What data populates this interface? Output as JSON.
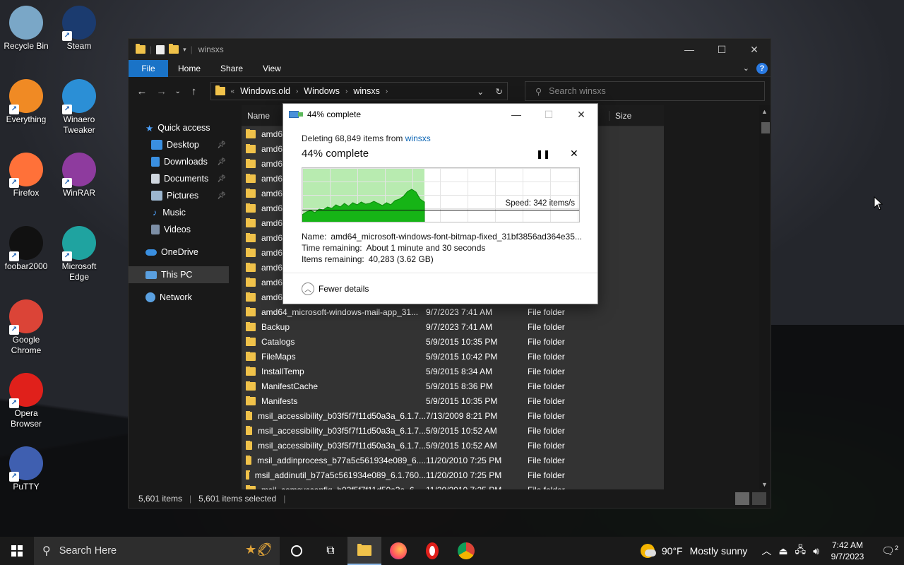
{
  "desktop": {
    "icons": [
      {
        "label": "Recycle Bin",
        "icon": "recycle-bin-icon",
        "color": "#7aa7c7"
      },
      {
        "label": "Steam",
        "icon": "steam-icon",
        "color": "#1b3b6f"
      },
      {
        "label": "Everything",
        "icon": "everything-icon",
        "color": "#f08a24"
      },
      {
        "label": "Winaero Tweaker",
        "icon": "winaero-tweaker-icon",
        "color": "#2b8fd6"
      },
      {
        "label": "Firefox",
        "icon": "firefox-icon",
        "color": "#ff7139"
      },
      {
        "label": "WinRAR",
        "icon": "winrar-icon",
        "color": "#8e3b9e"
      },
      {
        "label": "foobar2000",
        "icon": "foobar2000-icon",
        "color": "#111111"
      },
      {
        "label": "Microsoft Edge",
        "icon": "edge-icon",
        "color": "#1fa3a0"
      },
      {
        "label": "Google Chrome",
        "icon": "chrome-icon",
        "color": "#db4437"
      },
      {
        "label": "Opera Browser",
        "icon": "opera-icon",
        "color": "#e0201b"
      },
      {
        "label": "PuTTY",
        "icon": "putty-icon",
        "color": "#3f5fb0"
      }
    ]
  },
  "explorer": {
    "title": "winsxs",
    "ribbon_tabs": [
      "File",
      "Home",
      "Share",
      "View"
    ],
    "breadcrumb": [
      "Windows.old",
      "Windows",
      "winsxs"
    ],
    "search_placeholder": "Search winsxs",
    "nav": {
      "quick_access": "Quick access",
      "items": [
        "Desktop",
        "Downloads",
        "Documents",
        "Pictures",
        "Music",
        "Videos"
      ],
      "onedrive": "OneDrive",
      "this_pc": "This PC",
      "network": "Network"
    },
    "columns": {
      "name": "Name",
      "size": "Size"
    },
    "rows": [
      {
        "name": "amd64",
        "date": "",
        "type": ""
      },
      {
        "name": "amd64",
        "date": "",
        "type": ""
      },
      {
        "name": "amd64",
        "date": "",
        "type": ""
      },
      {
        "name": "amd64",
        "date": "",
        "type": ""
      },
      {
        "name": "amd64",
        "date": "",
        "type": ""
      },
      {
        "name": "amd64",
        "date": "",
        "type": ""
      },
      {
        "name": "amd64",
        "date": "",
        "type": ""
      },
      {
        "name": "amd64",
        "date": "",
        "type": ""
      },
      {
        "name": "amd64",
        "date": "",
        "type": ""
      },
      {
        "name": "amd64",
        "date": "",
        "type": ""
      },
      {
        "name": "amd64",
        "date": "",
        "type": ""
      },
      {
        "name": "amd64",
        "date": "",
        "type": ""
      },
      {
        "name": "amd64_microsoft-windows-mail-app_31...",
        "date": "9/7/2023 7:41 AM",
        "type": "File folder"
      },
      {
        "name": "Backup",
        "date": "9/7/2023 7:41 AM",
        "type": "File folder"
      },
      {
        "name": "Catalogs",
        "date": "5/9/2015 10:35 PM",
        "type": "File folder"
      },
      {
        "name": "FileMaps",
        "date": "5/9/2015 10:42 PM",
        "type": "File folder"
      },
      {
        "name": "InstallTemp",
        "date": "5/9/2015 8:34 AM",
        "type": "File folder"
      },
      {
        "name": "ManifestCache",
        "date": "5/9/2015 8:36 PM",
        "type": "File folder"
      },
      {
        "name": "Manifests",
        "date": "5/9/2015 10:35 PM",
        "type": "File folder"
      },
      {
        "name": "msil_accessibility_b03f5f7f11d50a3a_6.1.7...",
        "date": "7/13/2009 8:21 PM",
        "type": "File folder"
      },
      {
        "name": "msil_accessibility_b03f5f7f11d50a3a_6.1.7...",
        "date": "5/9/2015 10:52 AM",
        "type": "File folder"
      },
      {
        "name": "msil_accessibility_b03f5f7f11d50a3a_6.1.7...",
        "date": "5/9/2015 10:52 AM",
        "type": "File folder"
      },
      {
        "name": "msil_addinprocess_b77a5c561934e089_6....",
        "date": "11/20/2010 7:25 PM",
        "type": "File folder"
      },
      {
        "name": "msil_addinutil_b77a5c561934e089_6.1.760...",
        "date": "11/20/2010 7:25 PM",
        "type": "File folder"
      },
      {
        "name": "msil_comsvcconfig_b03f5f7f11d50a3a_6....",
        "date": "11/20/2010 7:25 PM",
        "type": "File folder"
      }
    ],
    "status": {
      "items": "5,601 items",
      "selected": "5,601 items selected"
    }
  },
  "dialog": {
    "title": "44% complete",
    "line1_prefix": "Deleting 68,849 items from",
    "line1_link": "winsxs",
    "heading": "44% complete",
    "progress_percent": 44,
    "speed": "Speed: 342 items/s",
    "name_label": "Name:",
    "name_value": "amd64_microsoft-windows-font-bitmap-fixed_31bf3856ad364e35...",
    "time_label": "Time remaining:",
    "time_value": "About 1 minute and 30 seconds",
    "items_label": "Items remaining:",
    "items_value": "40,283 (3.62 GB)",
    "footer": "Fewer details",
    "accent_color": "#0ba80b"
  },
  "taskbar": {
    "search_placeholder": "Search Here",
    "weather_temp": "90°F",
    "weather_desc": "Mostly sunny",
    "time": "7:42 AM",
    "date": "9/7/2023",
    "notifications": "2"
  }
}
